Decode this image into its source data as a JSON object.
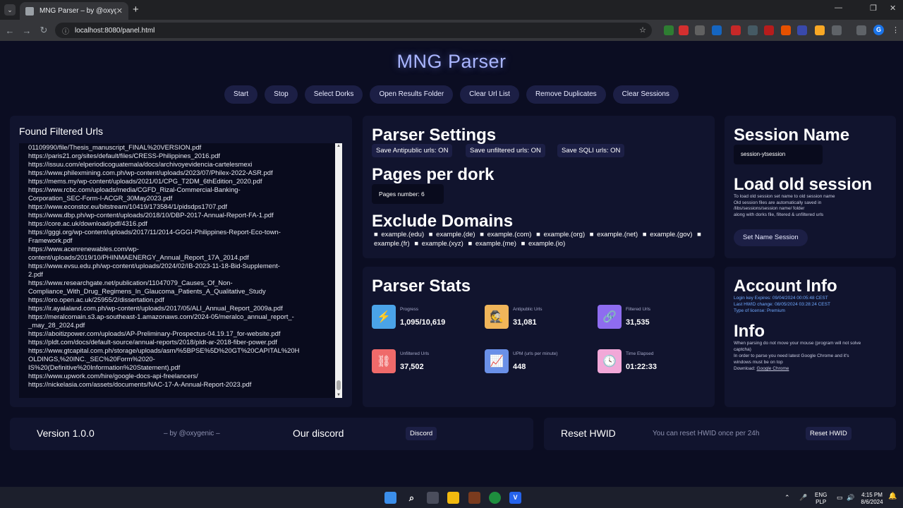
{
  "browser": {
    "tab_title": "MNG Parser – by @oxygenic",
    "url": "localhost:8080/panel.html"
  },
  "app": {
    "title": "MNG Parser",
    "toolbar": [
      "Start",
      "Stop",
      "Select Dorks",
      "Open Results Folder",
      "Clear Url List",
      "Remove Duplicates",
      "Clear Sessions"
    ]
  },
  "found_urls": {
    "heading": "Found Filtered Urls",
    "lines": [
      "01109990/file/Thesis_manuscript_FINAL%20VERSION.pdf",
      "https://paris21.org/sites/default/files/CRESS-Philippines_2016.pdf",
      "https://issuu.com/elperiodicoguatemala/docs/archivoyevidencia-cartelesmexi",
      "https://www.philexmining.com.ph/wp-content/uploads/2023/07/Philex-2022-ASR.pdf",
      "https://mems.my/wp-content/uploads/2021/01/CPG_T2DM_6thEdition_2020.pdf",
      "https://www.rcbc.com/uploads/media/CGFD_Rizal-Commercial-Banking-",
      "Corporation_SEC-Form-I-ACGR_30May2023.pdf",
      "https://www.econstor.eu/bitstream/10419/173584/1/pidsdps1707.pdf",
      "https://www.dbp.ph/wp-content/uploads/2018/10/DBP-2017-Annual-Report-FA-1.pdf",
      "https://core.ac.uk/download/pdf/4316.pdf",
      "https://gggi.org/wp-content/uploads/2017/11/2014-GGGI-Philippines-Report-Eco-town-",
      "Framework.pdf",
      "https://www.acenrenewables.com/wp-",
      "content/uploads/2019/10/PHINMAENERGY_Annual_Report_17A_2014.pdf",
      "https://www.evsu.edu.ph/wp-content/uploads/2024/02/IB-2023-11-18-Bid-Supplement-",
      "2.pdf",
      "https://www.researchgate.net/publication/11047079_Causes_Of_Non-",
      "Compliance_With_Drug_Regimens_In_Glaucoma_Patients_A_Qualitative_Study",
      "https://oro.open.ac.uk/25955/2/dissertation.pdf",
      "https://ir.ayalaland.com.ph/wp-content/uploads/2017/05/ALI_Annual_Report_2009a.pdf",
      "https://meralcomain.s3.ap-southeast-1.amazonaws.com/2024-05/meralco_annual_report_-",
      "_may_28_2024.pdf",
      "https://aboitizpower.com/uploads/AP-Preliminary-Prospectus-04.19.17_for-website.pdf",
      "https://pldt.com/docs/default-source/annual-reports/2018/pldt-ar-2018-fiber-power.pdf",
      "https://www.gtcapital.com.ph/storage/uploads/asm/%5BPSE%5D%20GT%20CAPITAL%20H",
      "OLDINGS,%20INC._SEC%20Form%2020-",
      "IS%20(Definitive%20Information%20Statement).pdf",
      "https://www.upwork.com/hire/google-docs-api-freelancers/",
      "https://nickelasia.com/assets/documents/NAC-17-A-Annual-Report-2023.pdf"
    ]
  },
  "settings": {
    "heading": "Parser Settings",
    "toggles": [
      "Save Antipublic urls: ON",
      "Save unfiltered urls: ON",
      "Save SQLI urls: ON"
    ],
    "pages_heading": "Pages per dork",
    "pages_value": "Pages number: 6",
    "exclude_heading": "Exclude Domains",
    "domains": [
      "example.(edu)",
      "example.(de)",
      "example.(com)",
      "example.(org)",
      "example.(net)",
      "example.(gov)",
      "example.(fr)",
      "example.(xyz)",
      "example.(me)",
      "example.(io)"
    ]
  },
  "session": {
    "heading": "Session Name",
    "value": "session-ytsession",
    "load_heading": "Load old session",
    "help": [
      "To load old session set name to old session name",
      "Old session files are automatically saved in",
      "/libs/sessions/session name/ folder",
      "along with dorks file, filtered & unfiltered urls"
    ],
    "button": "Set Name Session"
  },
  "stats": {
    "heading": "Parser Stats",
    "items": [
      {
        "label": "Progress",
        "value": "1,095/10,619",
        "icon": "lightning-icon",
        "glyph": "⚡",
        "color": "#4aa3e8"
      },
      {
        "label": "Antipublic Urls",
        "value": "31,081",
        "icon": "spy-icon",
        "glyph": "🕵",
        "color": "#f0b55a"
      },
      {
        "label": "Filtered Urls",
        "value": "31,535",
        "icon": "link-icon",
        "glyph": "🔗",
        "color": "#8e6cf0"
      },
      {
        "label": "Unfiltered Urls",
        "value": "37,502",
        "icon": "broken-link-icon",
        "glyph": "⛓",
        "color": "#ef6a6a"
      },
      {
        "label": "UPM (urls per minute)",
        "value": "448",
        "icon": "chart-icon",
        "glyph": "📈",
        "color": "#6a90e8"
      },
      {
        "label": "Time Elapsed",
        "value": "01:22:33",
        "icon": "clock-icon",
        "glyph": "🕓",
        "color": "#f2a8d8"
      }
    ]
  },
  "account": {
    "heading": "Account Info",
    "lines": [
      "Login key Expires: 09/04/2024 00:05:48 CEST",
      "Last HWID change: 08/05/2024 03:28:24 CEST",
      "Type of license: Premium"
    ],
    "info_heading": "Info",
    "info_lines": [
      "When parsing do not move your mouse (program will not solve",
      "captcha)",
      "In order to parse you need latest Google Chrome and it's",
      "windows must be on top"
    ],
    "download_label": "Download:",
    "download_link": "Google Chrome"
  },
  "footer": {
    "version": "Version 1.0.0",
    "by": "– by @oxygenic –",
    "discord_heading": "Our discord",
    "discord_button": "Discord",
    "reset_heading": "Reset HWID",
    "reset_note": "You can reset HWID once per 24h",
    "reset_button": "Reset HWID"
  },
  "taskbar": {
    "lang": "ENG",
    "layout": "PLP",
    "time": "4:15 PM",
    "date": "8/6/2024"
  }
}
